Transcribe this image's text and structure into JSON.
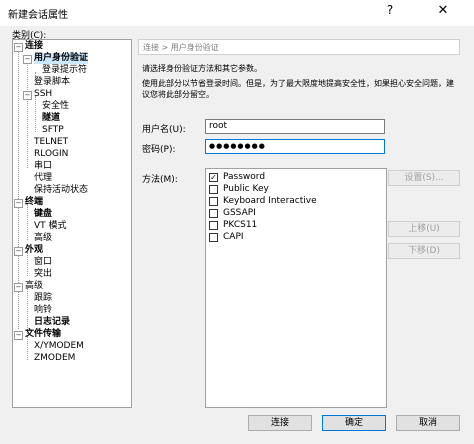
{
  "window": {
    "title": "新建会话属性",
    "help_icon": "?",
    "close_icon": "✕"
  },
  "category_label": "类别(C):",
  "tree": [
    {
      "label": "连接",
      "bold": true,
      "expander": "−"
    },
    {
      "label": "用户身份验证",
      "bold": true,
      "expander": "−"
    },
    {
      "label": "登录提示符"
    },
    {
      "label": "登录脚本"
    },
    {
      "label": "SSH",
      "expander": "−"
    },
    {
      "label": "安全性"
    },
    {
      "label": "隧道",
      "bold": true
    },
    {
      "label": "SFTP"
    },
    {
      "label": "TELNET"
    },
    {
      "label": "RLOGIN"
    },
    {
      "label": "串口"
    },
    {
      "label": "代理"
    },
    {
      "label": "保持活动状态"
    },
    {
      "label": "终端",
      "bold": true,
      "expander": "−"
    },
    {
      "label": "键盘",
      "bold": true
    },
    {
      "label": "VT 模式"
    },
    {
      "label": "高级"
    },
    {
      "label": "外观",
      "bold": true,
      "expander": "−"
    },
    {
      "label": "窗口"
    },
    {
      "label": "突出"
    },
    {
      "label": "高级",
      "expander": "−"
    },
    {
      "label": "跟踪"
    },
    {
      "label": "响铃"
    },
    {
      "label": "日志记录",
      "bold": true
    },
    {
      "label": "文件传输",
      "bold": true,
      "expander": "−"
    },
    {
      "label": "X/YMODEM"
    },
    {
      "label": "ZMODEM"
    }
  ],
  "panel": {
    "breadcrumb": "连接 > 用户身份验证",
    "desc1": "请选择身份验证方法和其它参数。",
    "desc2": "使用此部分以节省登录时间。但是，为了最大限度地提高安全性，如果担心安全问题，建",
    "desc3": "议您将此部分留空。"
  },
  "form": {
    "username_label": "用户名(U):",
    "username_value": "root",
    "password_label": "密码(P):",
    "password_value": "●●●●●●●●",
    "method_label": "方法(M):"
  },
  "methods": [
    {
      "label": "Password",
      "checked": true
    },
    {
      "label": "Public Key",
      "checked": false
    },
    {
      "label": "Keyboard Interactive",
      "checked": false
    },
    {
      "label": "GSSAPI",
      "checked": false
    },
    {
      "label": "PKCS11",
      "checked": false
    },
    {
      "label": "CAPI",
      "checked": false
    }
  ],
  "buttons": {
    "settings": "设置(S)...",
    "move_up": "上移(U)",
    "move_down": "下移(D)",
    "connect": "连接",
    "ok": "确定",
    "cancel": "取消"
  },
  "colors": {
    "selection": "#cce8ff",
    "focus_border": "#0078d7"
  }
}
